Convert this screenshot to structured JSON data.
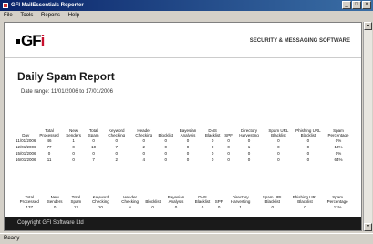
{
  "window": {
    "title": "GFI MailEssentials Reporter"
  },
  "menu": [
    "File",
    "Tools",
    "Reports",
    "Help"
  ],
  "header": {
    "logo_prefix": "GF",
    "logo_suffix": "i",
    "tagline": "SECURITY & MESSAGING SOFTWARE"
  },
  "report": {
    "title": "Daily Spam Report",
    "date_range": "Date range:  11/01/2006 to 17/01/2006",
    "table1": {
      "headers": [
        "Day",
        "Total Processed",
        "New Senders",
        "Total Spam",
        "Keyword Checking",
        "Header Checking",
        "Blocklist",
        "Bayesian Analysis",
        "DNS Blacklist",
        "SPF",
        "Directory Harvesting",
        "Spam URL Blacklist",
        "Phishing URL Blacklist",
        "Spam Percentage"
      ],
      "rows": [
        [
          "11/01/2006",
          "46",
          "1",
          "0",
          "0",
          "0",
          "0",
          "0",
          "0",
          "0",
          "0",
          "0",
          "0",
          "0%"
        ],
        [
          "12/01/2006",
          "77",
          "0",
          "10",
          "7",
          "2",
          "0",
          "0",
          "0",
          "0",
          "1",
          "0",
          "0",
          "13%"
        ],
        [
          "15/01/2006",
          "0",
          "0",
          "0",
          "0",
          "0",
          "0",
          "0",
          "0",
          "0",
          "0",
          "0",
          "0",
          "0%"
        ],
        [
          "16/01/2006",
          "11",
          "0",
          "7",
          "2",
          "4",
          "0",
          "0",
          "0",
          "0",
          "0",
          "0",
          "0",
          "64%"
        ]
      ]
    },
    "table2": {
      "headers": [
        "Total Processed",
        "New Senders",
        "Total Spam",
        "Keyword Checking",
        "Header Checking",
        "Blocklist",
        "Bayesian Analysis",
        "DNS Blacklist",
        "SPF",
        "Directory Harvesting",
        "Spam URL Blacklist",
        "Phishing URL Blacklist",
        "Spam Percentage"
      ],
      "rows": [
        [
          "137",
          "0",
          "17",
          "10",
          "6",
          "0",
          "0",
          "0",
          "0",
          "1",
          "0",
          "0",
          "11%"
        ]
      ]
    }
  },
  "footer": {
    "copyright": "Copyright GFI Software Ltd"
  },
  "status": {
    "text": "Ready"
  }
}
